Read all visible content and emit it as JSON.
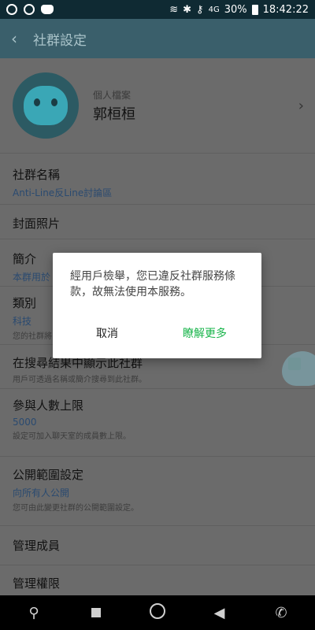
{
  "status_bar": {
    "wifi_label": "4G",
    "battery": "30%",
    "time": "18:42:22"
  },
  "app_bar": {
    "title": "社群設定"
  },
  "profile": {
    "label": "個人檔案",
    "name": "郭桓桓"
  },
  "rows": {
    "community_name": {
      "title": "社群名稱",
      "value": "Anti-Line反Line討論區"
    },
    "cover_photo": {
      "title": "封面照片"
    },
    "intro": {
      "title": "簡介",
      "value": "本群用於"
    },
    "category": {
      "title": "類別",
      "value": "科技",
      "desc": "您的社群將"
    },
    "show_in_search": {
      "title": "在搜尋結果中顯示此社群",
      "desc": "用戶可透過名稱或簡介搜尋到此社群。"
    },
    "member_limit": {
      "title": "參與人數上限",
      "value": "5000",
      "desc": "設定可加入聊天室的成員數上限。"
    },
    "visibility": {
      "title": "公開範圍設定",
      "value": "向所有人公開",
      "desc": "您可由此變更社群的公開範圍設定。"
    },
    "manage_members": {
      "title": "管理成員"
    },
    "manage_admins": {
      "title": "管理權限"
    }
  },
  "dialog": {
    "message": "經用戶檢舉，您已違反社群服務條款，故無法使用本服務。",
    "cancel_label": "取消",
    "learn_more_label": "瞭解更多"
  },
  "colors": {
    "accent": "#19b54b",
    "appbar": "#3a5f6b"
  }
}
